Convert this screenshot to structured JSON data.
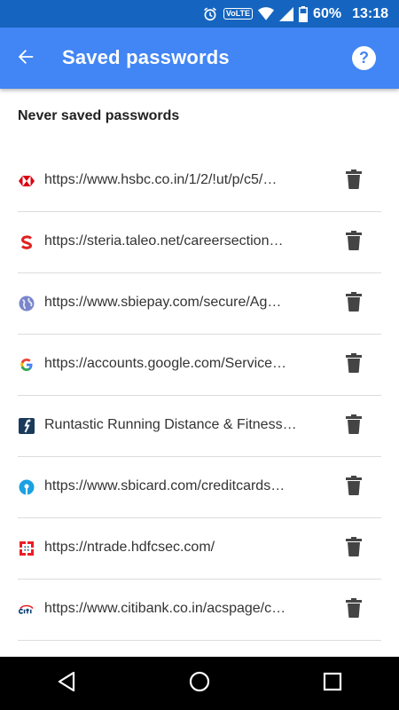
{
  "status_bar": {
    "volte": "VoLTE",
    "battery": "60%",
    "time": "13:18",
    "icons": [
      "alarm-icon",
      "wifi-icon",
      "signal-icon",
      "battery-icon"
    ]
  },
  "app_bar": {
    "title": "Saved passwords",
    "back_icon": "arrow-left-icon",
    "help_icon": "help-icon",
    "help_glyph": "?",
    "color": "#4285f4"
  },
  "section": {
    "heading": "Never saved passwords"
  },
  "items": [
    {
      "text": "https://www.hsbc.co.in/1/2/!ut/p/c5/…",
      "icon": "hsbc-favicon"
    },
    {
      "text": "https://steria.taleo.net/careersection…",
      "icon": "steria-favicon"
    },
    {
      "text": "https://www.sbiepay.com/secure/Ag…",
      "icon": "globe-favicon"
    },
    {
      "text": "https://accounts.google.com/Service…",
      "icon": "google-favicon"
    },
    {
      "text": "Runtastic Running Distance & Fitness…",
      "icon": "runtastic-favicon"
    },
    {
      "text": "https://www.sbicard.com/creditcards…",
      "icon": "sbi-favicon"
    },
    {
      "text": "https://ntrade.hdfcsec.com/",
      "icon": "hdfc-favicon"
    },
    {
      "text": "https://www.citibank.co.in/acspage/c…",
      "icon": "citi-favicon"
    }
  ],
  "nav": {
    "back": "back-triangle-icon",
    "home": "home-circle-icon",
    "recents": "recents-square-icon"
  }
}
